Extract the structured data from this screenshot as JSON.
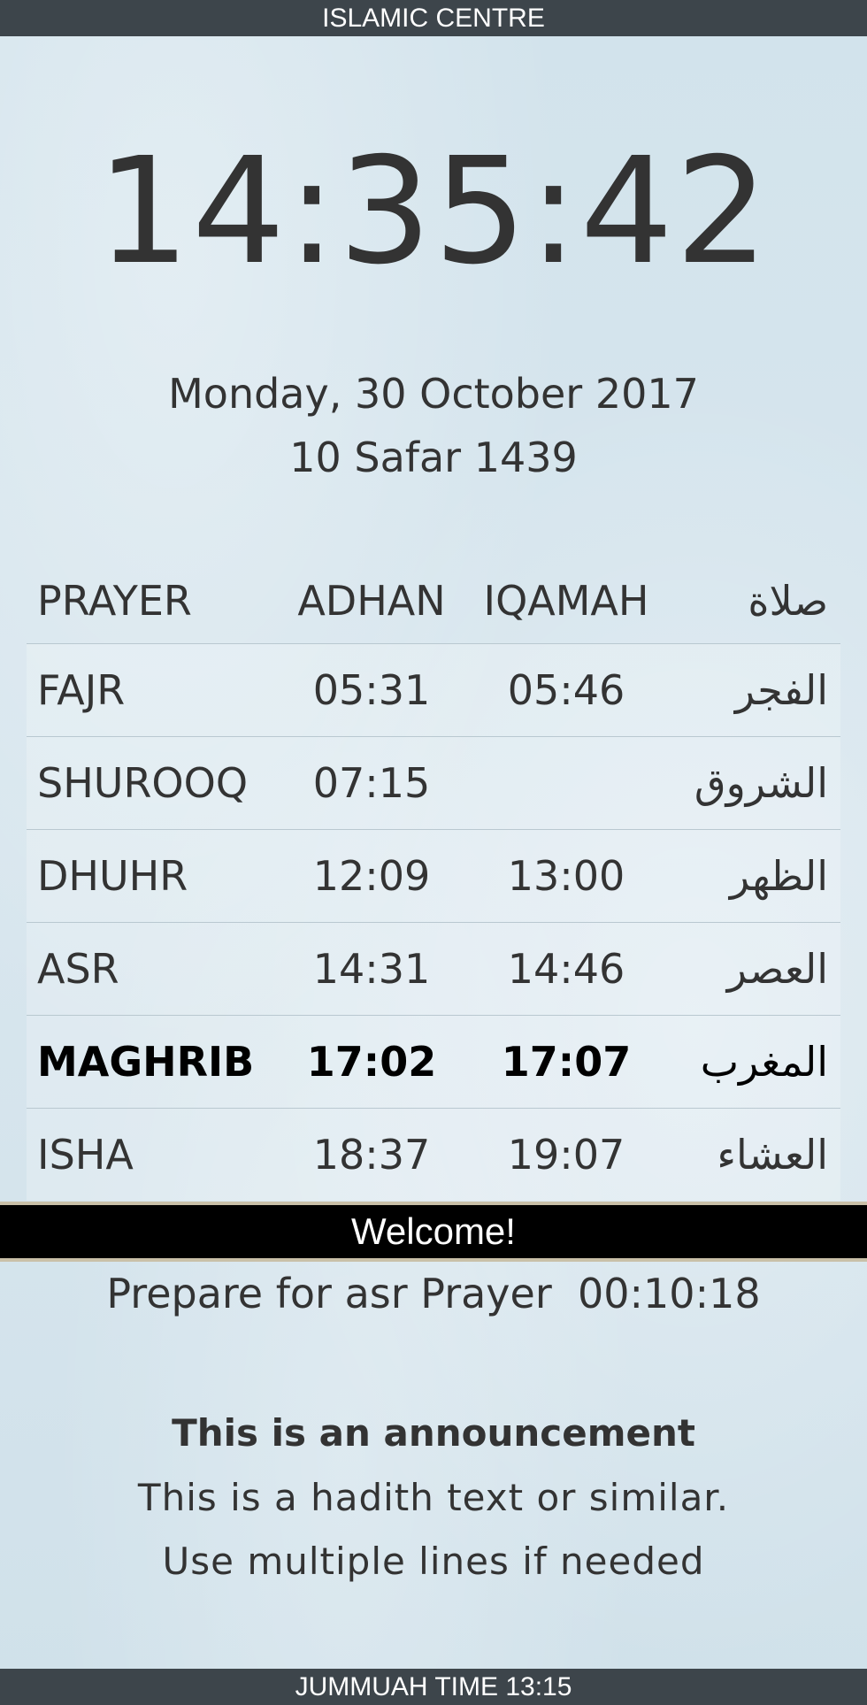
{
  "header": {
    "title": "ISLAMIC CENTRE"
  },
  "clock": {
    "time": "14:35:42"
  },
  "dates": {
    "gregorian": "Monday, 30 October 2017",
    "hijri": "10 Safar 1439"
  },
  "table": {
    "headers": {
      "prayer": "PRAYER",
      "adhan": "ADHAN",
      "iqamah": "IQAMAH",
      "arabic": "صلاة"
    },
    "rows": [
      {
        "name": "FAJR",
        "adhan": "05:31",
        "iqamah": "05:46",
        "arabic": "الفجر"
      },
      {
        "name": "SHUROOQ",
        "adhan": "07:15",
        "iqamah": "",
        "arabic": "الشروق"
      },
      {
        "name": "DHUHR",
        "adhan": "12:09",
        "iqamah": "13:00",
        "arabic": "الظهر"
      },
      {
        "name": "ASR",
        "adhan": "14:31",
        "iqamah": "14:46",
        "arabic": "العصر"
      },
      {
        "name": "MAGHRIB",
        "adhan": "17:02",
        "iqamah": "17:07",
        "arabic": "المغرب"
      },
      {
        "name": "ISHA",
        "adhan": "18:37",
        "iqamah": "19:07",
        "arabic": "العشاء"
      }
    ]
  },
  "ticker": {
    "message": "Welcome!"
  },
  "countdown": {
    "label": "Prepare for asr Prayer",
    "time": "00:10:18"
  },
  "announcement": {
    "title": "This is an announcement",
    "line1": "This is a hadith text or similar.",
    "line2": "Use multiple lines if needed"
  },
  "footer": {
    "text": "JUMMUAH TIME 13:15"
  }
}
